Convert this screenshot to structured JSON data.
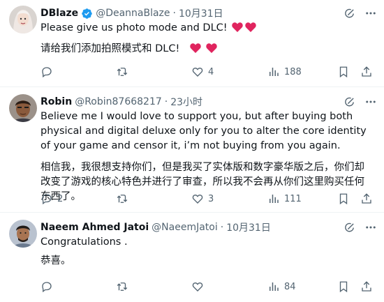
{
  "tweets": [
    {
      "name": "DBlaze",
      "verified": true,
      "handle": "@DeannaBlaze",
      "time": "10月31日",
      "line1": "Please give us photo mode and DLC!",
      "line2": "请给我们添加拍照模式和 DLC!",
      "replies": "",
      "retweets": "",
      "likes": "4",
      "views": "188"
    },
    {
      "name": "Robin",
      "handle": "@Robin87668217",
      "time": "23小时",
      "line1": "Believe me I would love to support you, but after buying both physical and digital deluxe only for you to alter the core identity of your game and censor it, i’m not buying from you again.",
      "line2": "相信我，我很想支持你们，但是我买了实体版和数字豪华版之后，你们却改变了游戏的核心特色并进行了审查，所以我不会再从你们这里购买任何东西了。",
      "replies": "2",
      "retweets": "",
      "likes": "3",
      "views": "111"
    },
    {
      "name": "Naeem Ahmed Jatoi",
      "handle": "@NaeemJatoi",
      "time": "10月31日",
      "line1": "Congratulations .",
      "line2": "恭喜。",
      "replies": "",
      "retweets": "",
      "likes": "",
      "views": "84"
    }
  ],
  "separator": "·",
  "colors": {
    "text": "#0f1419",
    "muted": "#536471",
    "verified": "#1d9bf0",
    "heart": "#e0245e",
    "divider": "#eff3f4"
  },
  "icons": [
    "grok-icon",
    "more-icon",
    "reply-icon",
    "retweet-icon",
    "like-icon",
    "views-icon",
    "bookmark-icon",
    "share-icon",
    "verified-icon",
    "red-heart-emoji"
  ]
}
